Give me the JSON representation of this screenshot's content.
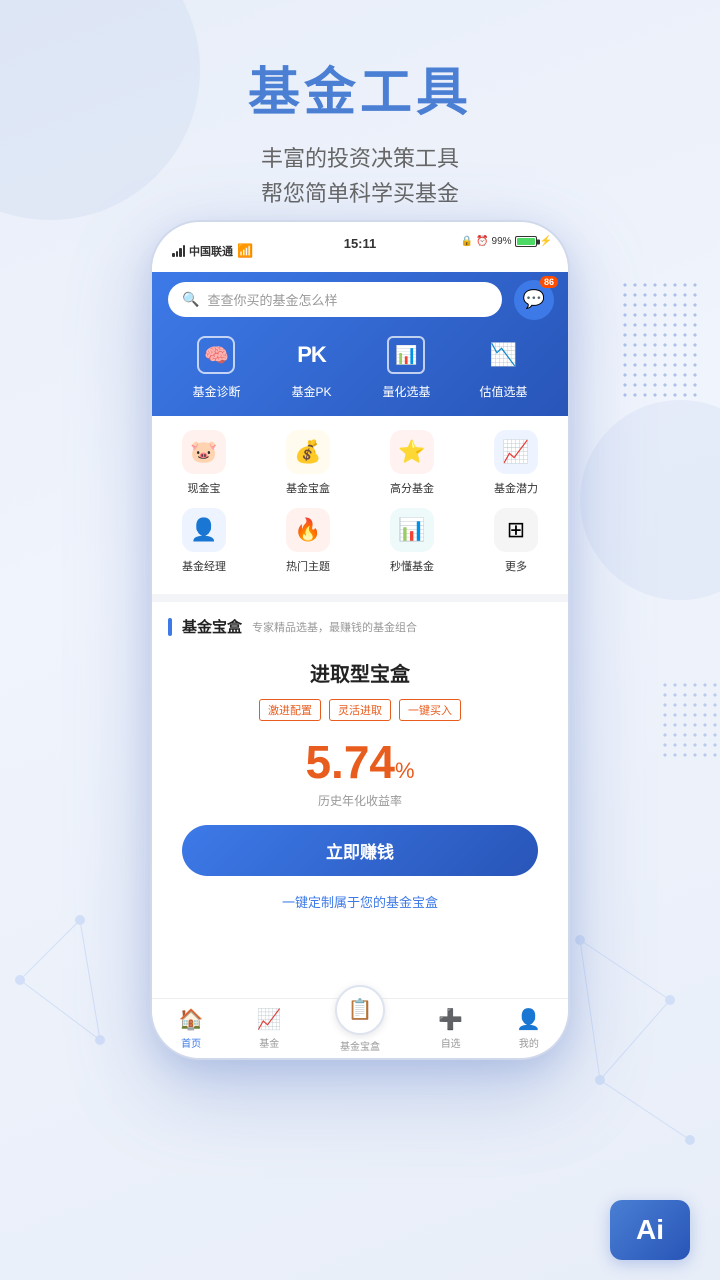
{
  "page": {
    "title": "基金工具",
    "subtitle_line1": "丰富的投资决策工具",
    "subtitle_line2": "帮您简单科学买基金"
  },
  "status_bar": {
    "carrier": "中国联通",
    "time": "15:11",
    "battery_percent": "99%"
  },
  "search": {
    "placeholder": "查查你买的基金怎么样",
    "badge_count": "86"
  },
  "top_menu": [
    {
      "id": "diagnosis",
      "label": "基金诊断"
    },
    {
      "id": "pk",
      "label": "基金PK"
    },
    {
      "id": "quant",
      "label": "量化选基"
    },
    {
      "id": "value",
      "label": "估值选基"
    }
  ],
  "grid_items_row1": [
    {
      "id": "cash",
      "label": "现金宝",
      "emoji": "🐷",
      "bg": "#fff2ee"
    },
    {
      "id": "box",
      "label": "基金宝盒",
      "emoji": "💰",
      "bg": "#fffbee"
    },
    {
      "id": "high",
      "label": "高分基金",
      "emoji": "⭐",
      "bg": "#fff2f0"
    },
    {
      "id": "potential",
      "label": "基金潜力",
      "emoji": "📈",
      "bg": "#eef4ff"
    }
  ],
  "grid_items_row2": [
    {
      "id": "manager",
      "label": "基金经理",
      "emoji": "👤",
      "bg": "#eef4ff"
    },
    {
      "id": "hot",
      "label": "热门主题",
      "emoji": "🔥",
      "bg": "#fff2ee"
    },
    {
      "id": "quick",
      "label": "秒懂基金",
      "emoji": "📊",
      "bg": "#eef9fa"
    },
    {
      "id": "more",
      "label": "更多",
      "emoji": "⊞",
      "bg": "#f5f5f5"
    }
  ],
  "section": {
    "title": "基金宝盒",
    "subtitle": "专家精品选基，最赚钱的基金组合"
  },
  "card": {
    "title": "进取型宝盒",
    "tags": [
      "激进配置",
      "灵活进取",
      "一键买入"
    ],
    "rate": "5.74",
    "rate_unit": "%",
    "rate_desc": "历史年化收益率",
    "cta_label": "立即赚钱",
    "link_label": "一键定制属于您的基金宝盒"
  },
  "bottom_nav": [
    {
      "id": "home",
      "label": "首页",
      "icon": "🏠",
      "active": true
    },
    {
      "id": "fund",
      "label": "基金",
      "icon": "📈",
      "active": false
    },
    {
      "id": "box",
      "label": "基金宝盒",
      "icon": "📋",
      "active": false,
      "center": true
    },
    {
      "id": "custom",
      "label": "自选",
      "icon": "➕",
      "active": false
    },
    {
      "id": "mine",
      "label": "我的",
      "icon": "👤",
      "active": false
    }
  ],
  "ai_text": "Ai"
}
